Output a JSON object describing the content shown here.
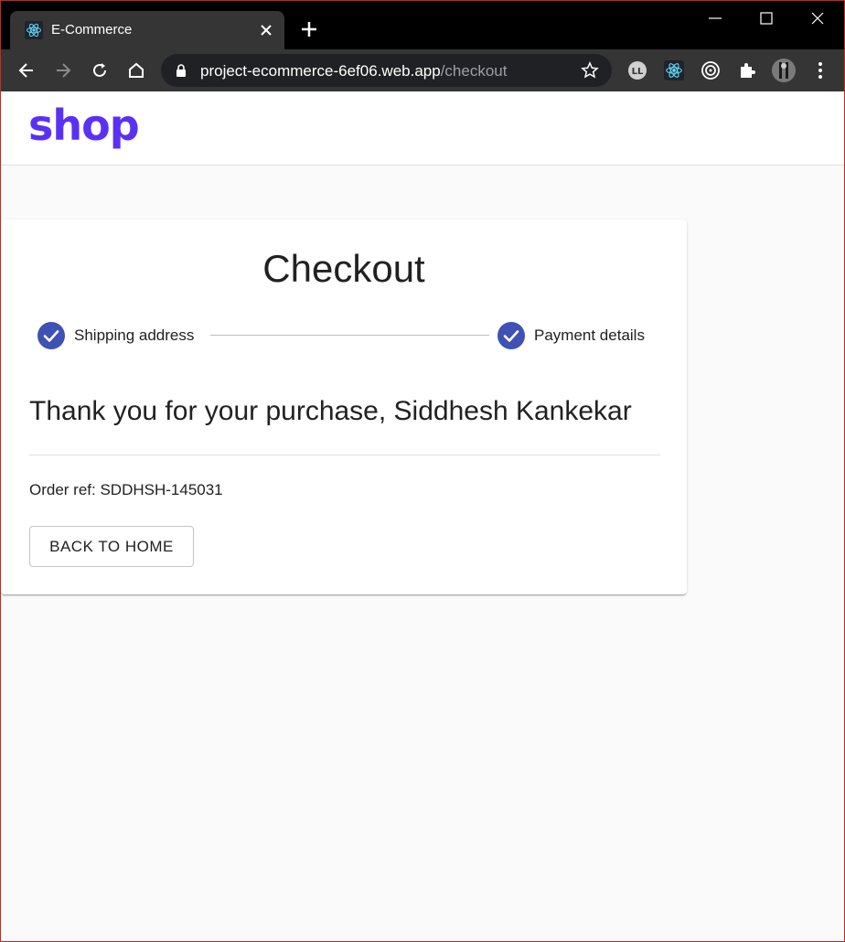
{
  "browser": {
    "tab_title": "E-Commerce",
    "url_host": "project-ecommerce-6ef06.web.app",
    "url_path": "/checkout"
  },
  "app": {
    "logo": "shop",
    "brand_color": "#5a31f4",
    "accent_color": "#3f51b5"
  },
  "checkout": {
    "title": "Checkout",
    "steps": [
      {
        "label": "Shipping address",
        "state": "completed"
      },
      {
        "label": "Payment details",
        "state": "completed"
      }
    ],
    "thank_you": "Thank you for your purchase, Siddhesh Kankekar",
    "order_ref": "Order ref: SDDHSH-145031",
    "back_button": "BACK TO HOME"
  }
}
